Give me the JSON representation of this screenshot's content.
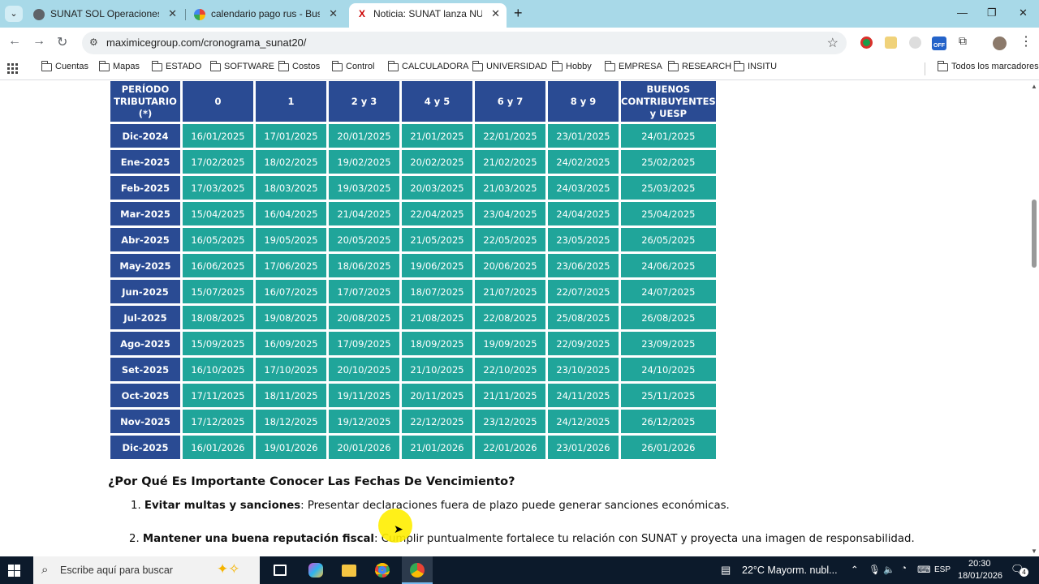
{
  "browser": {
    "tabs": [
      {
        "title": "SUNAT SOL Operaciones en Línea",
        "active": false
      },
      {
        "title": "calendario pago rus - Buscar con Google",
        "active": false
      },
      {
        "title": "Noticia: SUNAT lanza NUEVO Cronograma",
        "active": true
      }
    ],
    "url": "maximicegroup.com/cronograma_sunat20/",
    "bookmarks": [
      "Cuentas",
      "Mapas",
      "ESTADO",
      "SOFTWARE",
      "Costos",
      "Control",
      "CALCULADORA",
      "UNIVERSIDAD",
      "Hobby",
      "EMPRESA",
      "RESEARCH",
      "INSITU"
    ],
    "all_bookmarks": "Todos los marcadores",
    "ext_badge": "OFF"
  },
  "table": {
    "headers": [
      "PERÍODO TRIBUTARIO (*)",
      "0",
      "1",
      "2 y 3",
      "4 y 5",
      "6 y 7",
      "8 y 9",
      "BUENOS CONTRIBUYENTES y UESP"
    ],
    "rows": [
      {
        "period": "Dic-2024",
        "dates": [
          "16/01/2025",
          "17/01/2025",
          "20/01/2025",
          "21/01/2025",
          "22/01/2025",
          "23/01/2025",
          "24/01/2025"
        ]
      },
      {
        "period": "Ene-2025",
        "dates": [
          "17/02/2025",
          "18/02/2025",
          "19/02/2025",
          "20/02/2025",
          "21/02/2025",
          "24/02/2025",
          "25/02/2025"
        ]
      },
      {
        "period": "Feb-2025",
        "dates": [
          "17/03/2025",
          "18/03/2025",
          "19/03/2025",
          "20/03/2025",
          "21/03/2025",
          "24/03/2025",
          "25/03/2025"
        ]
      },
      {
        "period": "Mar-2025",
        "dates": [
          "15/04/2025",
          "16/04/2025",
          "21/04/2025",
          "22/04/2025",
          "23/04/2025",
          "24/04/2025",
          "25/04/2025"
        ]
      },
      {
        "period": "Abr-2025",
        "dates": [
          "16/05/2025",
          "19/05/2025",
          "20/05/2025",
          "21/05/2025",
          "22/05/2025",
          "23/05/2025",
          "26/05/2025"
        ]
      },
      {
        "period": "May-2025",
        "dates": [
          "16/06/2025",
          "17/06/2025",
          "18/06/2025",
          "19/06/2025",
          "20/06/2025",
          "23/06/2025",
          "24/06/2025"
        ]
      },
      {
        "period": "Jun-2025",
        "dates": [
          "15/07/2025",
          "16/07/2025",
          "17/07/2025",
          "18/07/2025",
          "21/07/2025",
          "22/07/2025",
          "24/07/2025"
        ]
      },
      {
        "period": "Jul-2025",
        "dates": [
          "18/08/2025",
          "19/08/2025",
          "20/08/2025",
          "21/08/2025",
          "22/08/2025",
          "25/08/2025",
          "26/08/2025"
        ]
      },
      {
        "period": "Ago-2025",
        "dates": [
          "15/09/2025",
          "16/09/2025",
          "17/09/2025",
          "18/09/2025",
          "19/09/2025",
          "22/09/2025",
          "23/09/2025"
        ]
      },
      {
        "period": "Set-2025",
        "dates": [
          "16/10/2025",
          "17/10/2025",
          "20/10/2025",
          "21/10/2025",
          "22/10/2025",
          "23/10/2025",
          "24/10/2025"
        ]
      },
      {
        "period": "Oct-2025",
        "dates": [
          "17/11/2025",
          "18/11/2025",
          "19/11/2025",
          "20/11/2025",
          "21/11/2025",
          "24/11/2025",
          "25/11/2025"
        ]
      },
      {
        "period": "Nov-2025",
        "dates": [
          "17/12/2025",
          "18/12/2025",
          "19/12/2025",
          "22/12/2025",
          "23/12/2025",
          "24/12/2025",
          "26/12/2025"
        ]
      },
      {
        "period": "Dic-2025",
        "dates": [
          "16/01/2026",
          "19/01/2026",
          "20/01/2026",
          "21/01/2026",
          "22/01/2026",
          "23/01/2026",
          "26/01/2026"
        ]
      }
    ]
  },
  "article": {
    "heading": "¿Por Qué Es Importante Conocer Las Fechas De Vencimiento?",
    "items": [
      {
        "num": "1.",
        "bold": "Evitar multas y sanciones",
        "text": ": Presentar declaraciones fuera de plazo puede generar sanciones económicas."
      },
      {
        "num": "2.",
        "bold": "Mantener una buena reputación fiscal",
        "text": ": Cumplir puntualmente fortalece tu relación con SUNAT y proyecta una imagen de responsabilidad."
      }
    ]
  },
  "taskbar": {
    "search_placeholder": "Escribe aquí para buscar",
    "weather": "22°C  Mayorm. nubl...",
    "language": "ESP",
    "time": "20:30",
    "date": "18/01/2026",
    "notifications": "4"
  },
  "colors": {
    "header_blue": "#2a4b93",
    "cell_teal": "#20a59a",
    "tabbar": "#a8d9e8"
  }
}
